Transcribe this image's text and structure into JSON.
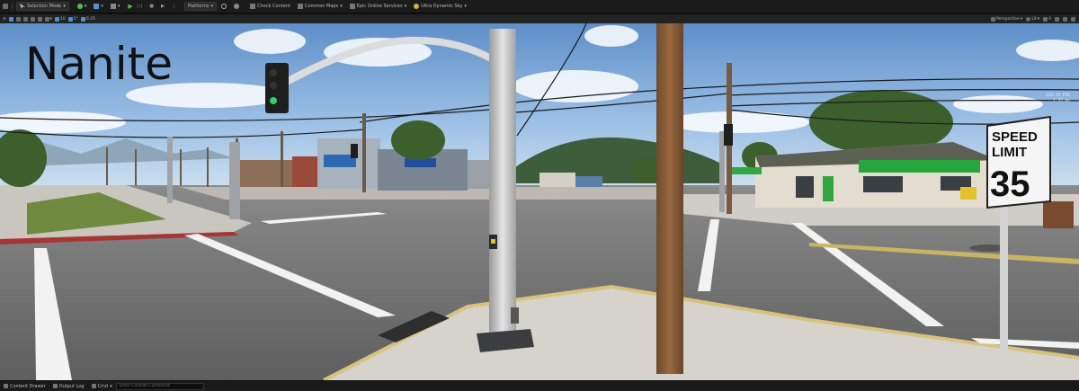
{
  "toolbar": {
    "mode_label": "Selection Mode",
    "platforms_label": "Platforms",
    "check_content_label": "Check Content",
    "common_maps_label": "Common Maps",
    "online_services_label": "Epic Online Services",
    "sky_label": "Ultra Dynamic Sky"
  },
  "viewport_toolbar": {
    "grid_value": "10",
    "rotation_value": "5°",
    "scale_value": "0.25",
    "view_mode_label": "Perspective",
    "lit_label": "Lit",
    "speed_value": "4"
  },
  "viewport": {
    "overlay_title": "Nanite",
    "stats_fps": "135.75 FPS",
    "stats_ms": "7.55 ms",
    "sign_line1": "SPEED",
    "sign_line2": "LIMIT",
    "sign_number": "35"
  },
  "statusbar": {
    "content_drawer_label": "Content Drawer",
    "output_log_label": "Output Log",
    "cmd_label": "Cmd",
    "console_placeholder": "Enter Console Command"
  },
  "colors": {
    "sky_top": "#5e8fc9",
    "road": "#6b6b6b",
    "sidewalk": "#c9c6c0",
    "grass": "#6f8a3f",
    "play_green": "#4fc04f",
    "accent": "#4a90d9"
  }
}
